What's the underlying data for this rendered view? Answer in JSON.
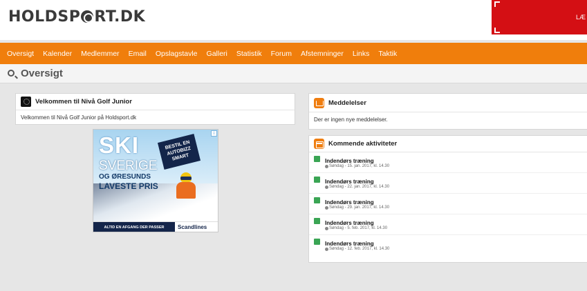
{
  "header": {
    "logo_text_before": "HOLDSP",
    "logo_text_after": "RT.DK",
    "banner_text": "LÆ"
  },
  "nav": {
    "items": [
      "Oversigt",
      "Kalender",
      "Medlemmer",
      "Email",
      "Opslagstavle",
      "Galleri",
      "Statistik",
      "Forum",
      "Afstemninger",
      "Links",
      "Taktik"
    ]
  },
  "page": {
    "title": "Oversigt"
  },
  "welcome": {
    "title": "Velkommen til Nivå Golf Junior",
    "body": "Velkommen til Nivå Golf Junior på Holdsport.dk"
  },
  "ad": {
    "ski": "SKI",
    "sverige": "SVERIGE",
    "line1": "OG ØRESUNDS",
    "line2": "LAVESTE PRIS",
    "badge": "BESTIL EN AUTOBIZZ SMART",
    "strip": "ALTID EN AFGANG DER PASSER",
    "brand": "Scandlines",
    "choice": "i"
  },
  "messages": {
    "title": "Meddelelser",
    "body": "Der er ingen nye meddelelser."
  },
  "activities": {
    "title": "Kommende aktiviteter",
    "items": [
      {
        "name": "Indendørs træning",
        "date": "Søndag - 15. jan. 2017, kl. 14.30"
      },
      {
        "name": "Indendørs træning",
        "date": "Søndag - 22. jan. 2017, kl. 14.30"
      },
      {
        "name": "Indendørs træning",
        "date": "Søndag - 29. jan. 2017, kl. 14.30"
      },
      {
        "name": "Indendørs træning",
        "date": "Søndag - 5. feb. 2017, kl. 14.30"
      },
      {
        "name": "Indendørs træning",
        "date": "Søndag - 12. feb. 2017, kl. 14.30"
      }
    ]
  },
  "colors": {
    "nav_orange": "#f07e0c",
    "activity_green": "#3aa554",
    "banner_red": "#d40f14"
  }
}
